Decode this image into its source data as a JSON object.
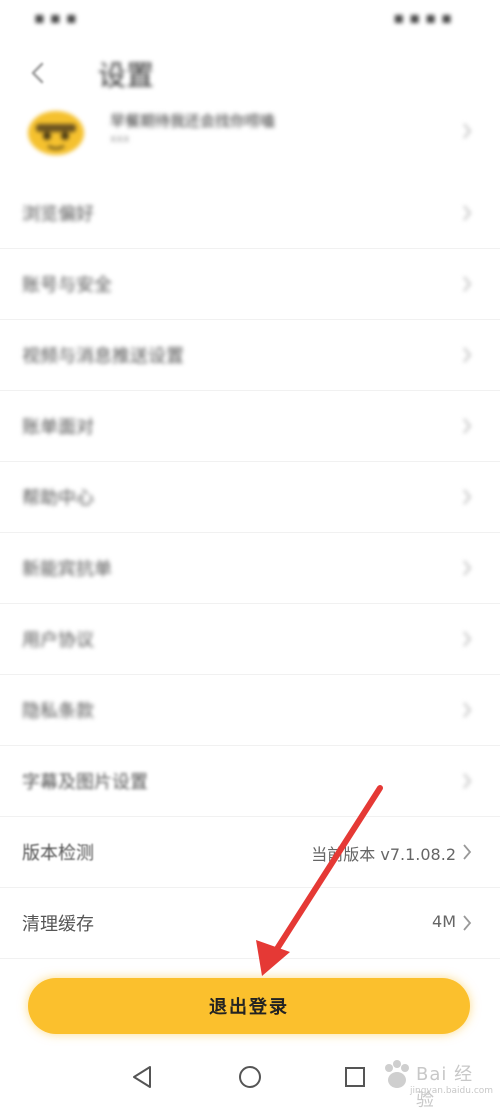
{
  "status_bar": {
    "left_text": "▪ ▪ ▪",
    "right_text": "▪ ▪ ▪ ▪"
  },
  "header": {
    "title": "设置"
  },
  "profile": {
    "name": "早餐期待我还会找你唠嗑",
    "subtitle": "xxx"
  },
  "settings": {
    "items": [
      {
        "label": "浏览偏好",
        "value": ""
      },
      {
        "label": "账号与安全",
        "value": ""
      },
      {
        "label": "视频与消息推送设置",
        "value": ""
      },
      {
        "label": "账单面对",
        "value": ""
      },
      {
        "label": "帮助中心",
        "value": ""
      },
      {
        "label": "新能宾抗单",
        "value": ""
      },
      {
        "label": "用户协议",
        "value": ""
      },
      {
        "label": "隐私条款",
        "value": ""
      },
      {
        "label": "字幕及图片设置",
        "value": ""
      },
      {
        "label": "版本检测",
        "value": "当前版本 v7.1.08.2"
      },
      {
        "label": "清理缓存",
        "value": "4M"
      }
    ]
  },
  "logout": {
    "label": "退出登录"
  },
  "watermark": {
    "text": "Bai 经验",
    "sub": "jingyan.baidu.com"
  },
  "colors": {
    "accent": "#fbc02d",
    "arrow": "#e53935"
  }
}
